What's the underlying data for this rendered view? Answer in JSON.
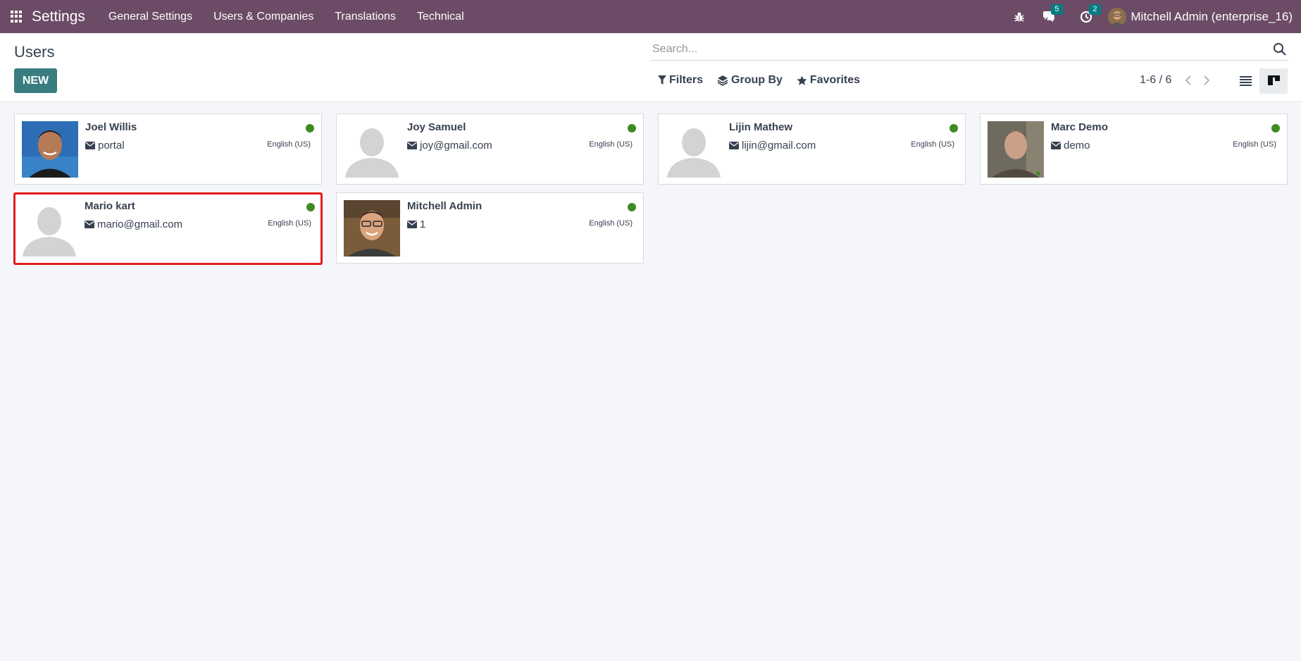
{
  "navbar": {
    "app_title": "Settings",
    "menu": [
      "General Settings",
      "Users & Companies",
      "Translations",
      "Technical"
    ],
    "messages_count": "5",
    "activities_count": "2",
    "user_name": "Mitchell Admin (enterprise_16)"
  },
  "control_panel": {
    "title": "Users",
    "new_label": "NEW",
    "search_placeholder": "Search...",
    "filters_label": "Filters",
    "group_by_label": "Group By",
    "favorites_label": "Favorites",
    "pager_value": "1-6 / 6"
  },
  "users": [
    {
      "name": "Joel Willis",
      "login": "portal",
      "lang": "English (US)",
      "avatar": "photo"
    },
    {
      "name": "Joy Samuel",
      "login": "joy@gmail.com",
      "lang": "English (US)",
      "avatar": "placeholder"
    },
    {
      "name": "Lijin Mathew",
      "login": "lijin@gmail.com",
      "lang": "English (US)",
      "avatar": "placeholder"
    },
    {
      "name": "Marc Demo",
      "login": "demo",
      "lang": "English (US)",
      "avatar": "photo"
    },
    {
      "name": "Mario kart",
      "login": "mario@gmail.com",
      "lang": "English (US)",
      "avatar": "placeholder"
    },
    {
      "name": "Mitchell Admin",
      "login": "1",
      "lang": "English (US)",
      "avatar": "photo"
    }
  ],
  "colors": {
    "navbar": "#6b4b65",
    "primary_button": "#3a7d80",
    "status_online": "#3f8b23",
    "highlight_border": "#e11d1d"
  }
}
